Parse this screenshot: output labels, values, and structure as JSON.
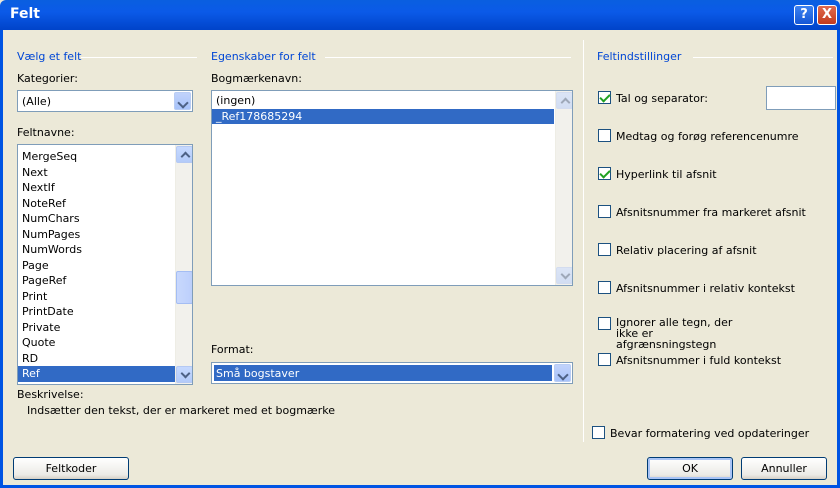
{
  "window": {
    "title": "Felt",
    "help_label": "?",
    "close_label": "X"
  },
  "left": {
    "group_title": "Vælg et felt",
    "categories_label": "Kategorier:",
    "category_value": "(Alle)",
    "fieldnames_label": "Feltnavne:",
    "fieldnames": [
      "MergeSeq",
      "Next",
      "NextIf",
      "NoteRef",
      "NumChars",
      "NumPages",
      "NumWords",
      "Page",
      "PageRef",
      "Print",
      "PrintDate",
      "Private",
      "Quote",
      "RD",
      "Ref"
    ],
    "selected_fieldname": "Ref"
  },
  "middle": {
    "group_title": "Egenskaber for felt",
    "bookmark_label": "Bogmærkenavn:",
    "bookmarks": [
      "(ingen)",
      "_Ref178685294"
    ],
    "selected_bookmark": "_Ref178685294",
    "format_label": "Format:",
    "format_value": "Små bogstaver"
  },
  "right": {
    "group_title": "Feltindstillinger",
    "options": [
      {
        "label": "Tal og separator:",
        "checked": true
      },
      {
        "label": "Medtag og forøg referencenumre",
        "checked": false
      },
      {
        "label": "Hyperlink til afsnit",
        "checked": true
      },
      {
        "label": "Afsnitsnummer fra markeret afsnit",
        "checked": false
      },
      {
        "label": "Relativ placering af afsnit",
        "checked": false
      },
      {
        "label": "Afsnitsnummer i relativ kontekst",
        "checked": false
      },
      {
        "label": "Ignorer alle tegn, der ikke er afgrænsningstegn",
        "checked": false
      },
      {
        "label": "Afsnitsnummer i fuld kontekst",
        "checked": false
      }
    ],
    "separator_value": "",
    "preserve_label": "Bevar formatering ved opdateringer",
    "preserve_checked": false
  },
  "description": {
    "label": "Beskrivelse:",
    "text": "Indsætter den tekst, der er markeret med et bogmærke"
  },
  "buttons": {
    "field_codes": "Feltkoder",
    "ok": "OK",
    "cancel": "Annuller"
  }
}
